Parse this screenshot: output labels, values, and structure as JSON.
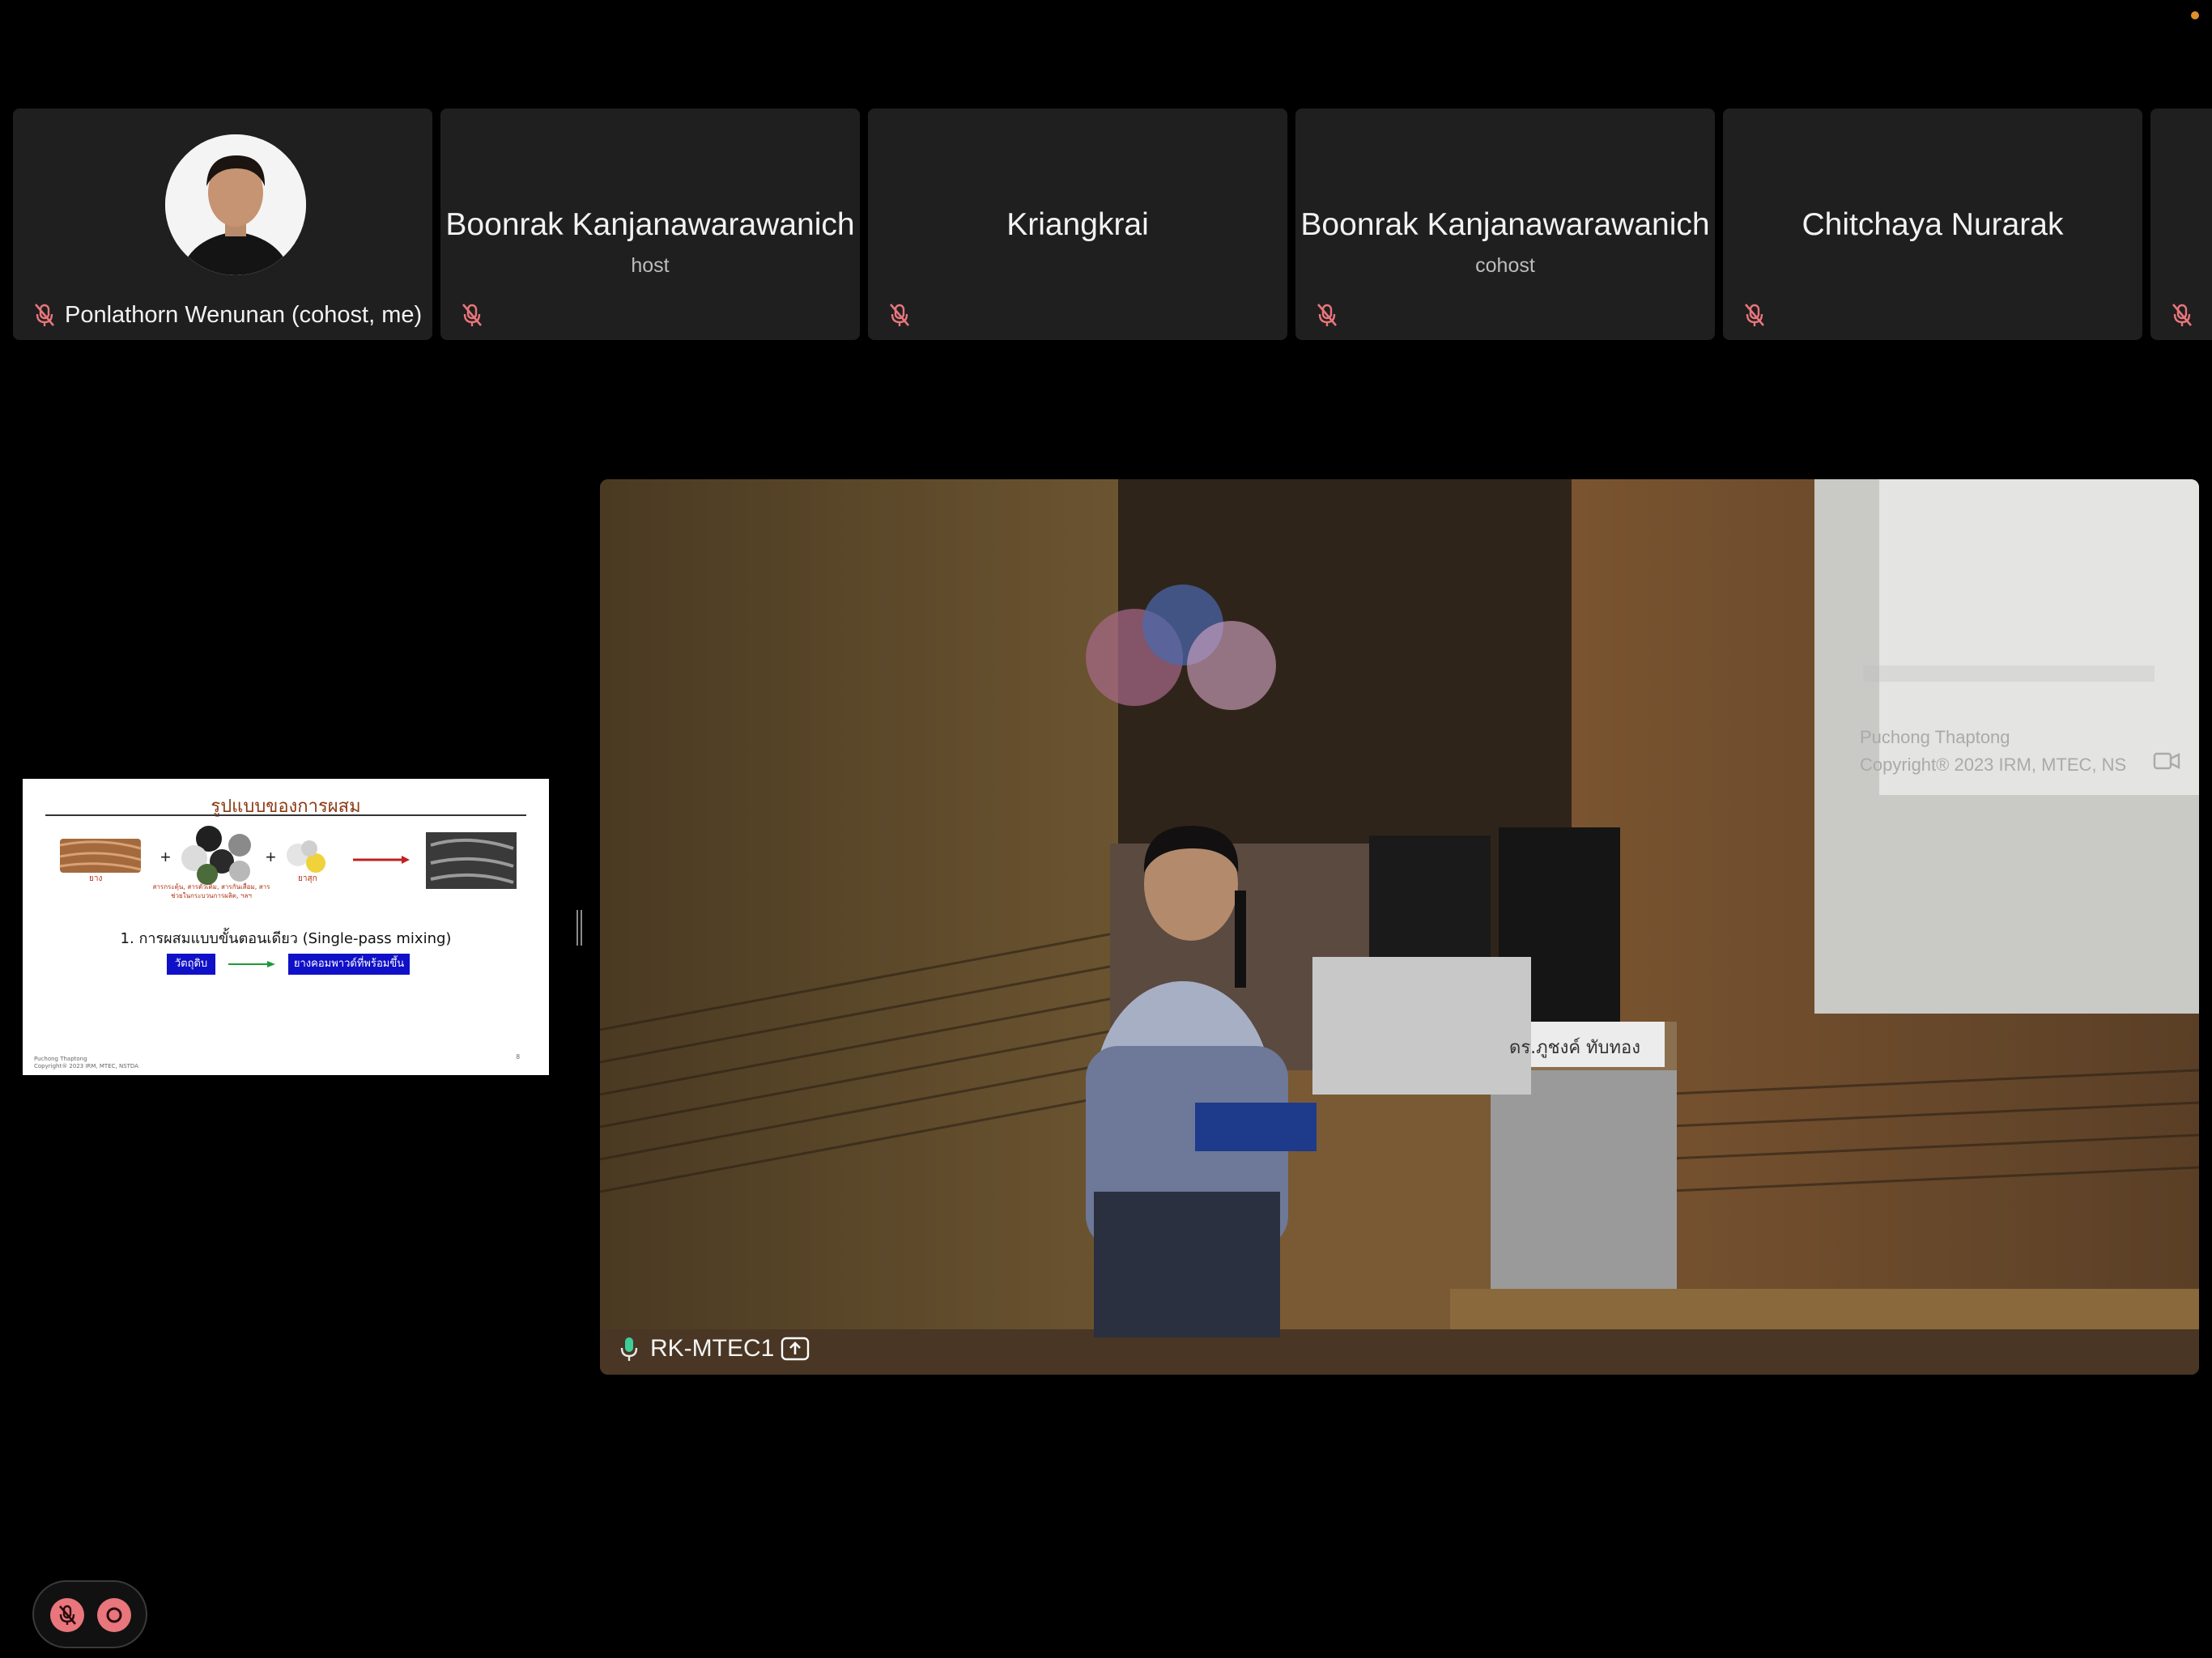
{
  "participants": [
    {
      "name": "",
      "role": "",
      "label": "Ponlathorn Wenunan (cohost, me)",
      "has_avatar": true,
      "mic": "muted-icon"
    },
    {
      "name": "Boonrak Kanjanawarawanich",
      "role": "host",
      "label": "",
      "mic": "muted-icon"
    },
    {
      "name": "Kriangkrai",
      "role": "",
      "label": "",
      "mic": "muted-icon"
    },
    {
      "name": "Boonrak Kanjanawarawanich",
      "role": "cohost",
      "label": "",
      "mic": "muted-icon"
    },
    {
      "name": "Chitchaya Nurarak",
      "role": "",
      "label": "",
      "mic": "muted-icon"
    }
  ],
  "shared_slide": {
    "title": "รูปแบบของการผสม",
    "ingredient_labels": [
      "ยาง",
      "สารกระตุ้น, สารตัวเติม, สารกันเสื่อม, สารช่วยในกระบวนการผลิต, ฯลฯ",
      "ยาสุก"
    ],
    "line1": "1. การผสมแบบขั้นตอนเดียว (Single-pass mixing)",
    "box_left": "วัตถุดิบ",
    "box_right": "ยางคอมพาวด์ที่พร้อมขึ้นรูป",
    "footer_author": "Puchong Thaptong",
    "footer_copyright": "Copyright® 2023 IRM, MTEC, NSTDA",
    "page_number": "8"
  },
  "main_video": {
    "speaker": "RK-MTEC1",
    "nameplate": "ดร.ภูชงค์ ทับทอง",
    "projector_author": "Puchong Thaptong",
    "projector_copyright": "Copyright® 2023 IRM, MTEC, NS"
  },
  "colors": {
    "tile_bg": "#1f1f1f",
    "muted_red": "#e8767c",
    "active_mic_green": "#3ccf9a",
    "status_dot": "#e0902a"
  }
}
